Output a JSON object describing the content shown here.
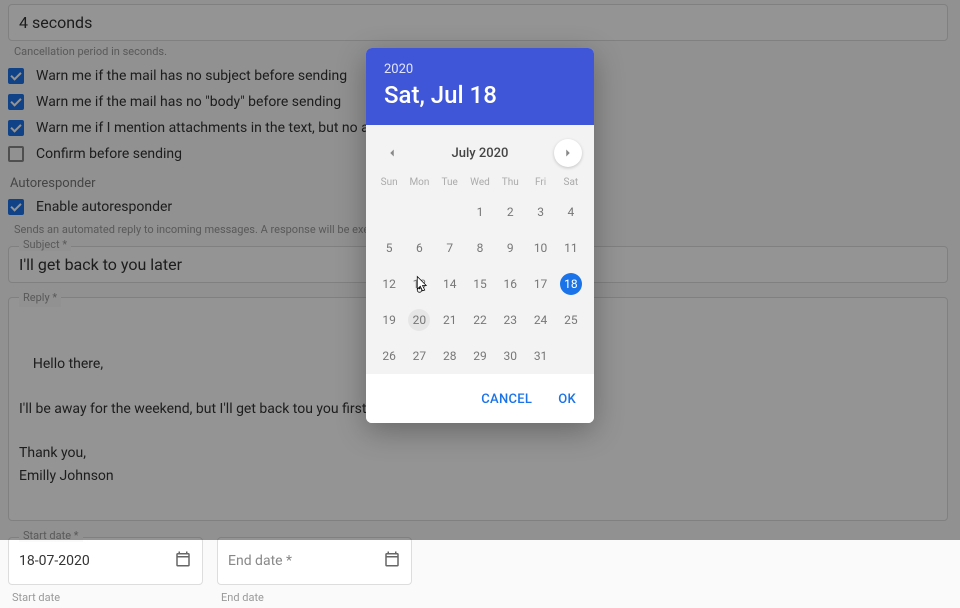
{
  "cancel_delay": {
    "value": "4 seconds",
    "helper": "Cancellation period in seconds."
  },
  "warnings": {
    "no_subject": {
      "checked": true,
      "label": "Warn me if the mail has no subject before sending"
    },
    "no_body": {
      "checked": true,
      "label": "Warn me if the mail has no \"body\" before sending"
    },
    "attachment": {
      "checked": true,
      "label": "Warn me if I mention attachments in the text, but no attachment"
    },
    "confirm": {
      "checked": false,
      "label": "Confirm before sending"
    }
  },
  "autoresponder": {
    "section_title": "Autoresponder",
    "enable": {
      "checked": true,
      "label": "Enable autoresponder"
    },
    "helper": "Sends an automated reply to incoming messages. A response will be executed at most",
    "subject": {
      "legend": "Subject *",
      "value": "I'll get back to you later"
    },
    "reply": {
      "legend": "Reply *",
      "value": "Hello there,\n\nI'll be away for the weekend, but I'll get back tou you first thing on Monday.\n\nThank you,\nEmilly Johnson"
    },
    "start_date": {
      "legend": "Start date *",
      "value": "18-07-2020",
      "helper": "Start date"
    },
    "end_date": {
      "legend": "End date *",
      "placeholder": "End date *",
      "helper": "End date"
    }
  },
  "datepicker": {
    "year": "2020",
    "date_label": "Sat, Jul 18",
    "month_label": "July 2020",
    "dow": [
      "Sun",
      "Mon",
      "Tue",
      "Wed",
      "Thu",
      "Fri",
      "Sat"
    ],
    "blank_leading": 3,
    "days": 31,
    "selected": 18,
    "hover": 20,
    "actions": {
      "cancel": "CANCEL",
      "ok": "OK"
    }
  }
}
